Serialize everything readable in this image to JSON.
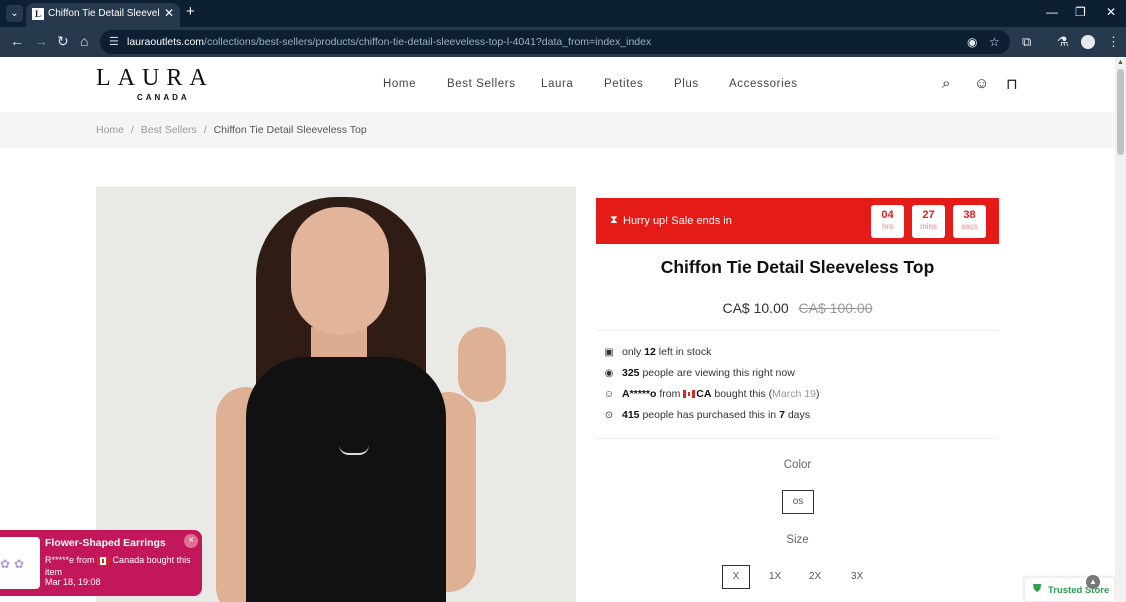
{
  "browser": {
    "tab_title": "Chiffon Tie Detail Sleeveless Top",
    "favicon_letter": "L",
    "url_host": "lauraoutlets.com",
    "url_path": "/collections/best-sellers/products/chiffon-tie-detail-sleeveless-top-l-4041?data_from=index_index"
  },
  "logo": {
    "main": "LAURA",
    "sub": "CANADA"
  },
  "nav": [
    "Home",
    "Best Sellers",
    "Laura",
    "Petites",
    "Plus",
    "Accessories"
  ],
  "breadcrumb": {
    "home": "Home",
    "sep": "/",
    "category": "Best Sellers",
    "current": "Chiffon Tie Detail Sleeveless Top"
  },
  "countdown": {
    "label": "Hurry up!  Sale ends in",
    "hours": "04",
    "hours_unit": "hrs",
    "mins": "27",
    "mins_unit": "mins",
    "secs": "38",
    "secs_unit": "secs",
    "color": "#e41b17"
  },
  "product": {
    "title": "Chiffon Tie Detail Sleeveless Top",
    "price_sale": "CA$ 10.00",
    "price_original": "CA$ 100.00"
  },
  "stats": {
    "stock_pre": "only",
    "stock_num": "12",
    "stock_post": "left in stock",
    "viewing_num": "325",
    "viewing_post": "people are viewing this right now",
    "buyer_name": "A*****o",
    "buyer_from": "from",
    "buyer_country": "CA",
    "buyer_post": "bought this (",
    "buyer_date": "March 19",
    "buyer_close": ")",
    "purchased_num": "415",
    "purchased_mid": "people has purchased this in",
    "purchased_days": "7",
    "purchased_post": "days"
  },
  "options": {
    "color_label": "Color",
    "color_value": "os",
    "size_label": "Size",
    "sizes": [
      "X",
      "1X",
      "2X",
      "3X"
    ],
    "selected_size": "X"
  },
  "toast": {
    "title": "Flower-Shaped Earrings",
    "buyer": "R*****e from",
    "country_text": "Canada bought this item",
    "time": "Mar 18, 19:08",
    "close": "×",
    "color": "#c2185b"
  },
  "trusted": {
    "label": "Trusted Store",
    "color": "#2e9e4f"
  }
}
